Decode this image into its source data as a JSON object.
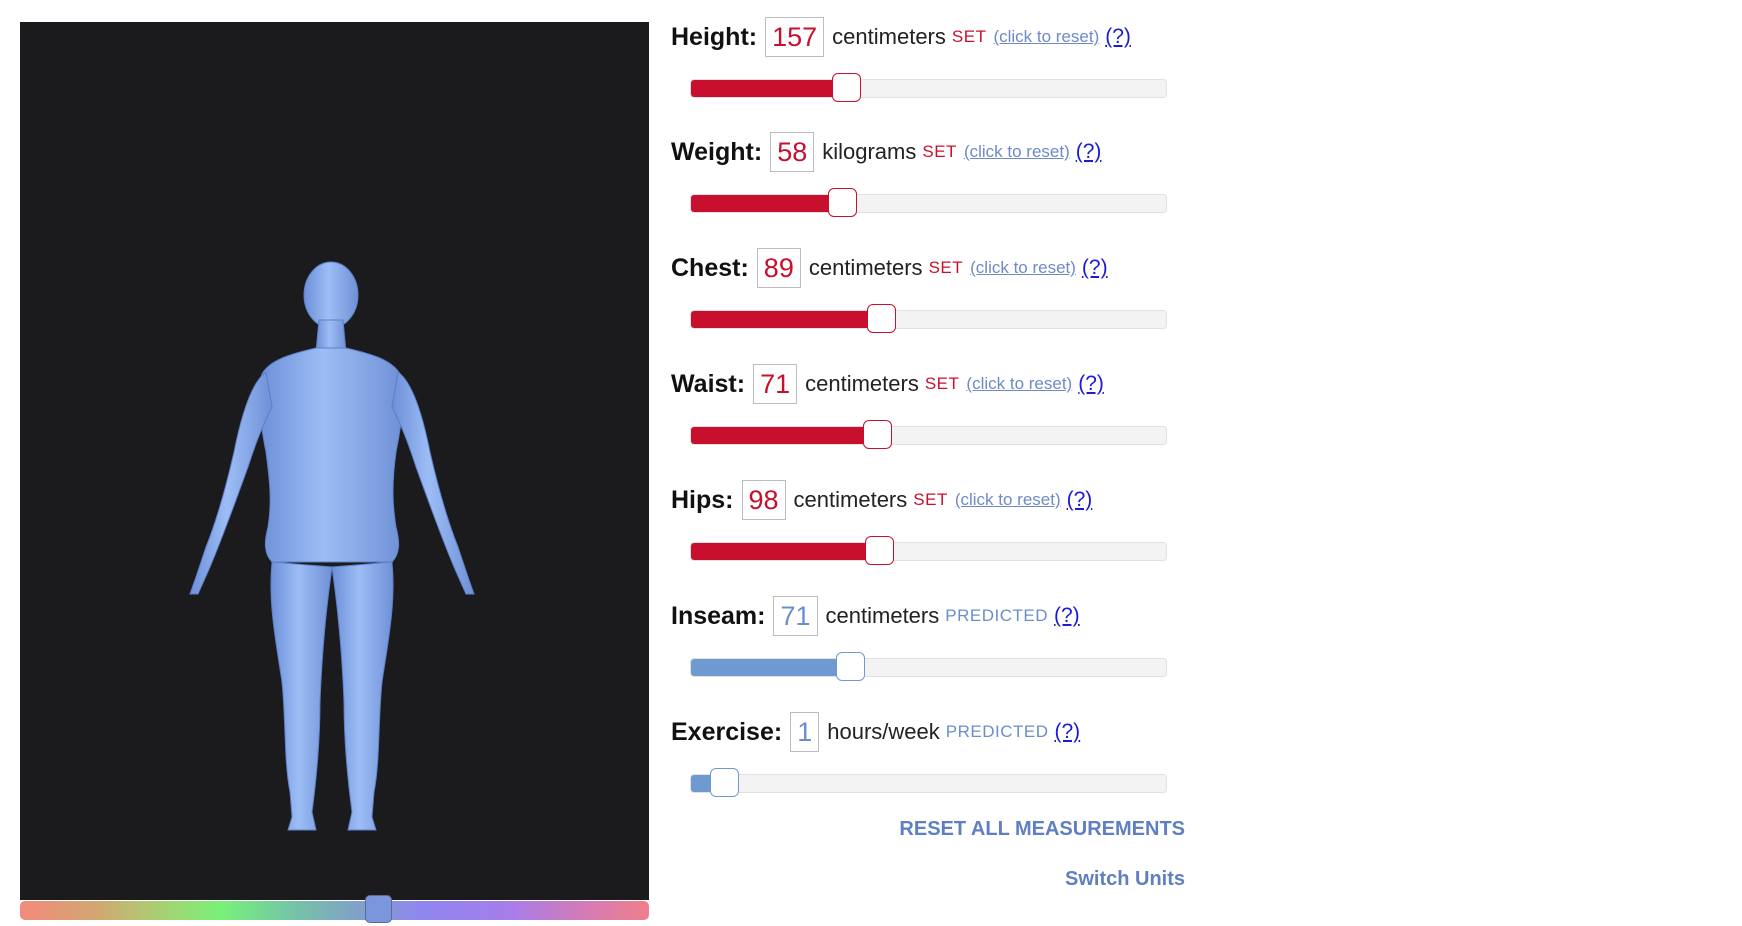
{
  "viewer": {
    "body_color": "#86a9ee",
    "background_color": "#1b1b1d",
    "color_slider": {
      "value": 0.57
    }
  },
  "measurements": [
    {
      "key": "height",
      "label": "Height:",
      "value": "157",
      "unit": "centimeters",
      "status": "SET",
      "reset_text": "(click to reset)",
      "help_text": "(?)",
      "slider_level": 0.325
    },
    {
      "key": "weight",
      "label": "Weight:",
      "value": "58",
      "unit": "kilograms",
      "status": "SET",
      "reset_text": "(click to reset)",
      "help_text": "(?)",
      "slider_level": 0.318
    },
    {
      "key": "chest",
      "label": "Chest:",
      "value": "89",
      "unit": "centimeters",
      "status": "SET",
      "reset_text": "(click to reset)",
      "help_text": "(?)",
      "slider_level": 0.4
    },
    {
      "key": "waist",
      "label": "Waist:",
      "value": "71",
      "unit": "centimeters",
      "status": "SET",
      "reset_text": "(click to reset)",
      "help_text": "(?)",
      "slider_level": 0.39
    },
    {
      "key": "hips",
      "label": "Hips:",
      "value": "98",
      "unit": "centimeters",
      "status": "SET",
      "reset_text": "(click to reset)",
      "help_text": "(?)",
      "slider_level": 0.395
    },
    {
      "key": "inseam",
      "label": "Inseam:",
      "value": "71",
      "unit": "centimeters",
      "status": "PREDICTED",
      "help_text": "(?)",
      "slider_level": 0.335
    },
    {
      "key": "exercise",
      "label": "Exercise:",
      "value": "1",
      "unit": "hours/week",
      "status": "PREDICTED",
      "help_text": "(?)",
      "slider_level": 0.07
    }
  ],
  "actions": {
    "reset_all": "RESET ALL MEASUREMENTS",
    "switch_units": "Switch Units"
  },
  "colors": {
    "set": "#c8102e",
    "predicted": "#6a8fc9",
    "link": "#1a1ad8"
  }
}
